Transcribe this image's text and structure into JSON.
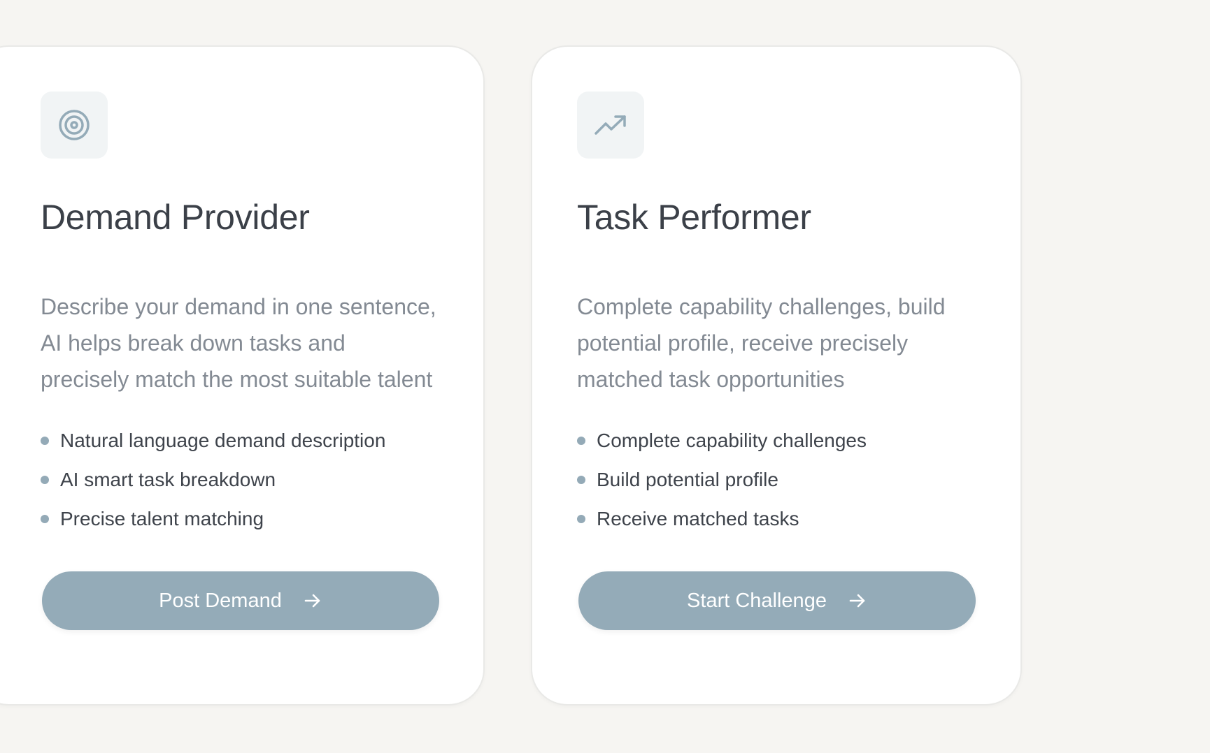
{
  "cards": [
    {
      "icon": "target-icon",
      "title": "Demand Provider",
      "description": "Describe your demand in one sentence, AI helps break down tasks and precisely match the most suitable talent",
      "features": [
        "Natural language demand description",
        "AI smart task breakdown",
        "Precise talent matching"
      ],
      "button_label": "Post Demand"
    },
    {
      "icon": "trending-up-icon",
      "title": "Task Performer",
      "description": "Complete capability challenges, build potential profile, receive precisely matched task opportunities",
      "features": [
        "Complete capability challenges",
        "Build potential profile",
        "Receive matched tasks"
      ],
      "button_label": "Start Challenge"
    }
  ],
  "colors": {
    "background": "#f6f5f2",
    "card": "#ffffff",
    "accent": "#94abb8",
    "icon": "#94abb8",
    "title": "#3b4048",
    "description": "#838a93"
  }
}
